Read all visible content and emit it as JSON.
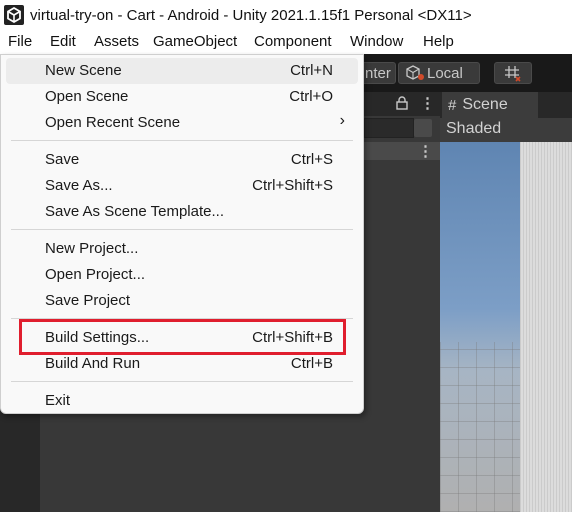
{
  "window": {
    "title": "virtual-try-on - Cart - Android - Unity 2021.1.15f1 Personal <DX11>"
  },
  "menubar": {
    "items": [
      "File",
      "Edit",
      "Assets",
      "GameObject",
      "Component",
      "Window",
      "Help"
    ]
  },
  "toolbar": {
    "pivot_label": "nter",
    "space_label": "Local"
  },
  "scene": {
    "tab_label": "Scene",
    "shading_mode": "Shaded"
  },
  "file_menu": {
    "items": [
      {
        "label": "New Scene",
        "shortcut": "Ctrl+N"
      },
      {
        "label": "Open Scene",
        "shortcut": "Ctrl+O"
      },
      {
        "label": "Open Recent Scene",
        "shortcut": "",
        "submenu_icon": "chevron-right-icon"
      },
      {
        "label": "Save",
        "shortcut": "Ctrl+S"
      },
      {
        "label": "Save As...",
        "shortcut": "Ctrl+Shift+S"
      },
      {
        "label": "Save As Scene Template...",
        "shortcut": ""
      },
      {
        "label": "New Project...",
        "shortcut": ""
      },
      {
        "label": "Open Project...",
        "shortcut": ""
      },
      {
        "label": "Save Project",
        "shortcut": ""
      },
      {
        "label": "Build Settings...",
        "shortcut": "Ctrl+Shift+B",
        "highlighted": true
      },
      {
        "label": "Build And Run",
        "shortcut": "Ctrl+B"
      },
      {
        "label": "Exit",
        "shortcut": ""
      }
    ]
  },
  "colors": {
    "highlight_box": "#e01e2e",
    "editor_background": "#383838"
  }
}
